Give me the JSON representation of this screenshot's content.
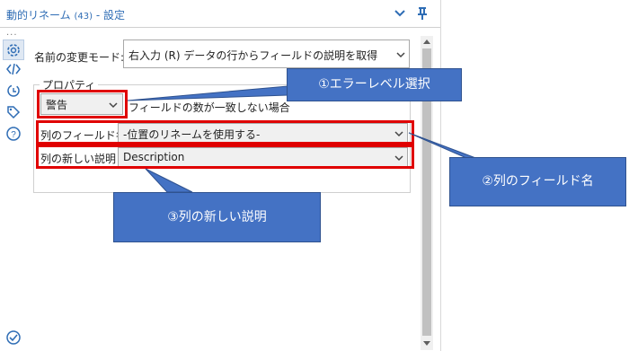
{
  "panel": {
    "title": "動的リネーム",
    "count": "(43)",
    "title_suffix": " - 設定",
    "overflow": "..."
  },
  "mode": {
    "label": "名前の変更モード:",
    "value": "右入力 (R) データの行からフィールドの説明を取得"
  },
  "properties": {
    "legend": "プロパティ",
    "error_level": "警告",
    "mismatch_text": "フィールドの数が一致しない場合",
    "field_name_label": "列のフィールド名",
    "field_name_value": "-位置のリネームを使用する-",
    "new_desc_label": "列の新しい説明",
    "new_desc_value": "Description"
  },
  "callouts": {
    "c1": "①エラーレベル選択",
    "c2": "②列のフィールド名",
    "c3": "③列の新しい説明"
  },
  "colors": {
    "accent": "#2f6db5",
    "highlight": "#e00000",
    "callout": "#4472c4"
  },
  "icons": [
    "chevron-down-icon",
    "pin-icon",
    "gear-icon",
    "code-icon",
    "refresh-icon",
    "tag-icon",
    "help-icon",
    "check-circle-icon"
  ]
}
